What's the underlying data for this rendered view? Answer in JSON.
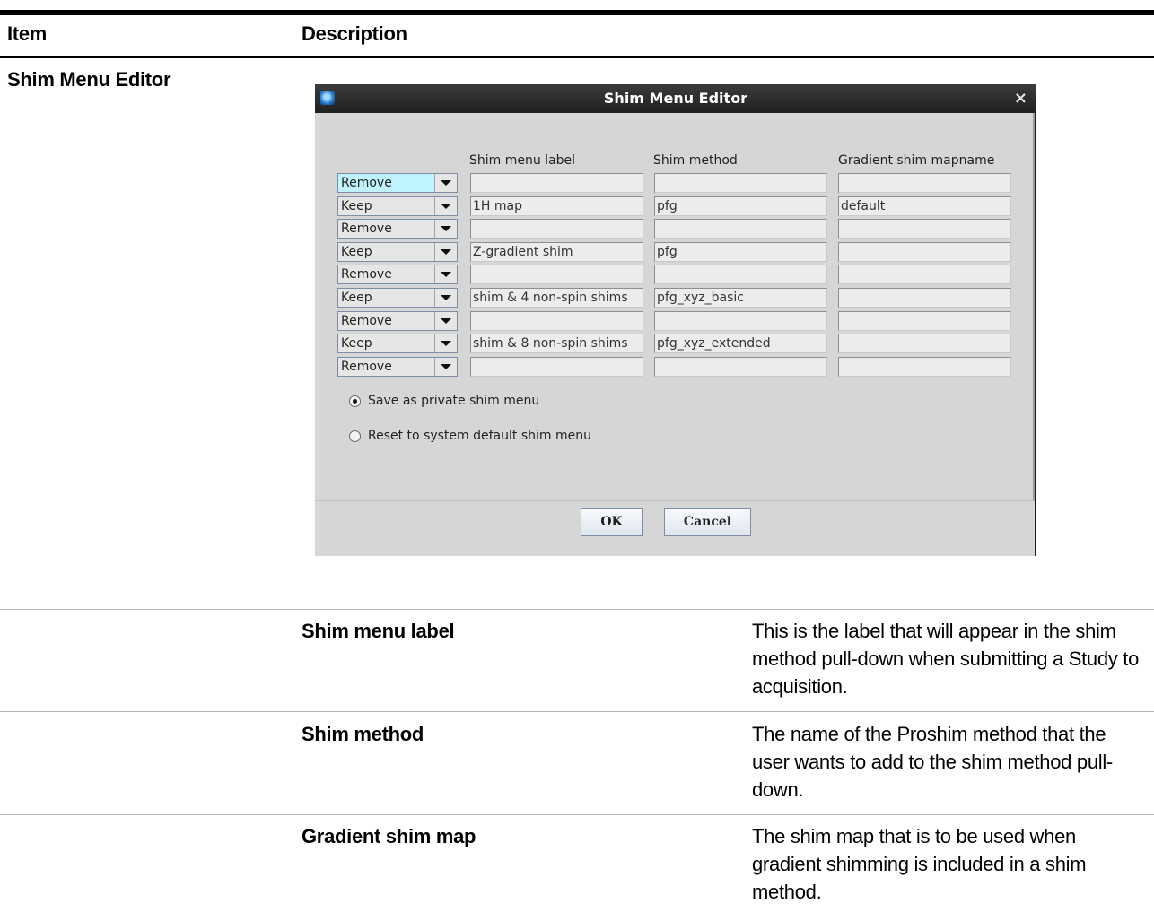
{
  "table": {
    "header_item": "Item",
    "header_description": "Description",
    "item_label": "Shim Menu Editor"
  },
  "dialog": {
    "title": "Shim Menu Editor",
    "close_glyph": "×",
    "columns": {
      "label": "Shim menu label",
      "method": "Shim method",
      "mapname": "Gradient shim mapname"
    },
    "rows": [
      {
        "action": "Remove",
        "label": "",
        "method": "",
        "mapname": "",
        "selected": true
      },
      {
        "action": "Keep",
        "label": "1H map",
        "method": "pfg",
        "mapname": "default"
      },
      {
        "action": "Remove",
        "label": "",
        "method": "",
        "mapname": ""
      },
      {
        "action": "Keep",
        "label": "Z-gradient shim",
        "method": "pfg",
        "mapname": ""
      },
      {
        "action": "Remove",
        "label": "",
        "method": "",
        "mapname": ""
      },
      {
        "action": "Keep",
        "label": "shim & 4 non-spin shims",
        "method": "pfg_xyz_basic",
        "mapname": ""
      },
      {
        "action": "Remove",
        "label": "",
        "method": "",
        "mapname": ""
      },
      {
        "action": "Keep",
        "label": "shim & 8 non-spin shims",
        "method": "pfg_xyz_extended",
        "mapname": ""
      },
      {
        "action": "Remove",
        "label": "",
        "method": "",
        "mapname": ""
      }
    ],
    "options": [
      {
        "label": "Save as private shim menu",
        "checked": true
      },
      {
        "label": "Reset to system default shim menu",
        "checked": false
      }
    ],
    "ok_label": "OK",
    "cancel_label": "Cancel"
  },
  "descriptions": [
    {
      "term": "Shim menu label",
      "text": "This is the label that will appear in the shim method pull-down when submitting a Study to acquisition."
    },
    {
      "term": "Shim method",
      "text": "The name of the Proshim method that the user wants to add to the shim method pull-down."
    },
    {
      "term": "Gradient shim map",
      "text": "The shim map that is to be used when gradient shimming is included in a shim method."
    }
  ],
  "colors": {
    "selected_combo": "#bff3ff",
    "dialog_bg": "#d6d6d6",
    "title_bar": "#2a2a2a"
  }
}
